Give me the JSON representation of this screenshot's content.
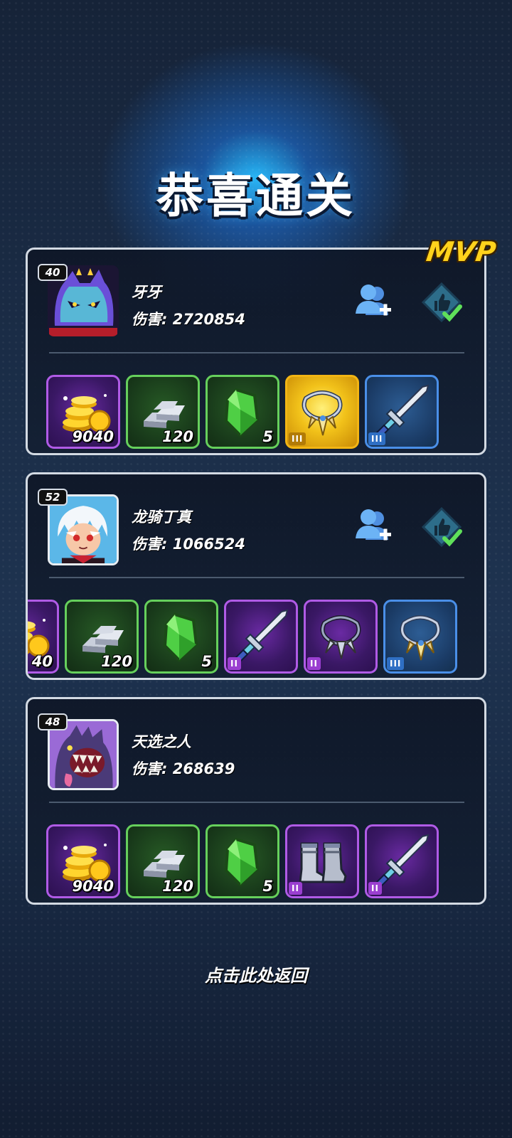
{
  "title": "恭喜通关",
  "mvp_label": "MVP",
  "return_label": "点击此处返回",
  "damage_prefix": "伤害: ",
  "players": [
    {
      "level": "40",
      "name": "牙牙",
      "damage": "2720854",
      "mvp": true,
      "avatar": "purple-demon-cat-avatar",
      "rewards": [
        {
          "icon": "gold-coins-icon",
          "frame": "purple",
          "qty": "9040"
        },
        {
          "icon": "silver-ingot-icon",
          "frame": "green",
          "qty": "120"
        },
        {
          "icon": "green-gem-icon",
          "frame": "green",
          "qty": "5"
        },
        {
          "icon": "necklace-icon",
          "frame": "gold",
          "tier": "III"
        },
        {
          "icon": "sword-icon",
          "frame": "blue",
          "tier": "III"
        }
      ]
    },
    {
      "level": "52",
      "name": "龙骑丁真",
      "damage": "1066524",
      "mvp": false,
      "avatar": "white-hair-hero-avatar",
      "rewards": [
        {
          "icon": "gold-coins-icon",
          "frame": "purple",
          "qty": "40",
          "partial": true
        },
        {
          "icon": "silver-ingot-icon",
          "frame": "green",
          "qty": "120"
        },
        {
          "icon": "green-gem-icon",
          "frame": "green",
          "qty": "5"
        },
        {
          "icon": "sword-icon",
          "frame": "purple",
          "tier": "II"
        },
        {
          "icon": "claw-necklace-icon",
          "frame": "purple",
          "tier": "II"
        },
        {
          "icon": "necklace-icon",
          "frame": "blue",
          "tier": "III"
        }
      ]
    },
    {
      "level": "48",
      "name": "天选之人",
      "damage": "268639",
      "mvp": false,
      "avatar": "purple-beast-avatar",
      "rewards": [
        {
          "icon": "gold-coins-icon",
          "frame": "purple",
          "qty": "9040"
        },
        {
          "icon": "silver-ingot-icon",
          "frame": "green",
          "qty": "120"
        },
        {
          "icon": "green-gem-icon",
          "frame": "green",
          "qty": "5"
        },
        {
          "icon": "armored-boots-icon",
          "frame": "purple",
          "tier": "II"
        },
        {
          "icon": "sword-icon",
          "frame": "purple",
          "tier": "II"
        }
      ]
    }
  ]
}
